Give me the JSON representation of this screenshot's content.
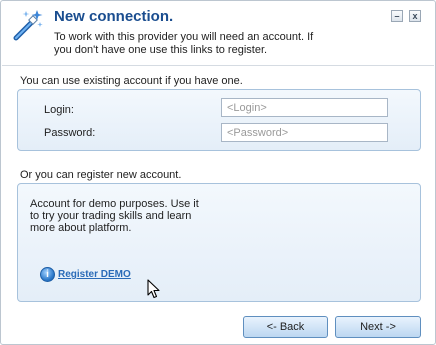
{
  "header": {
    "title": "New connection.",
    "subtitle": "To work with this provider you will need an account. If you don't have one use this links to register.",
    "icon": "magic-wand-icon",
    "minimize_glyph": "–",
    "close_glyph": "x"
  },
  "login_section": {
    "label": "You can use existing account if you have one.",
    "login_label": "Login:",
    "login_placeholder": "<Login>",
    "login_value": "",
    "password_label": "Password:",
    "password_placeholder": "<Password>",
    "password_value": ""
  },
  "register_section": {
    "label": "Or you can register new account.",
    "description": "Account for demo purposes. Use it to try your trading skills and learn more about platform.",
    "link_label": "Register DEMO",
    "link_icon": "info-icon",
    "info_glyph": "i"
  },
  "buttons": {
    "back_label": "<- Back",
    "next_label": "Next ->"
  },
  "colors": {
    "title": "#1a4d8f",
    "link": "#2a6bb8",
    "panel_border": "#a7c2dc",
    "button_border": "#5f8fbf"
  }
}
